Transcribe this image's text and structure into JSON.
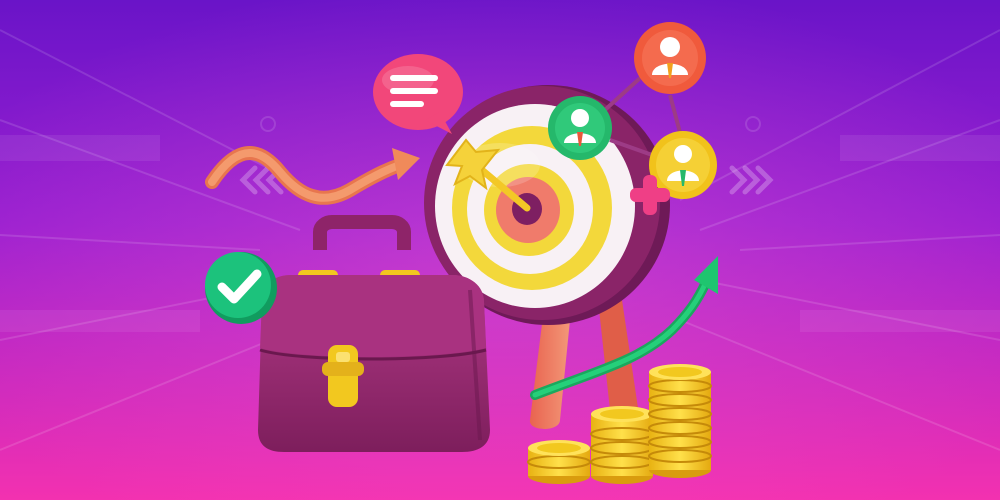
{
  "scene": {
    "description_colors": {
      "bg_top": "#6b15c9",
      "bg_bottom": "#f02fb4",
      "target_rim": "#7e1f62",
      "target_white": "#f7f1f4",
      "target_yellow": "#f3d83b",
      "target_coral": "#f07b6b",
      "briefcase": "#9e2a74",
      "briefcase_dark": "#7a1d58",
      "coin_gold": "#f2c81f",
      "check_green": "#19c07a",
      "arrow_green": "#19c86d",
      "arrow_orange": "#f08a5a",
      "speech_pink": "#f2477a",
      "avatar_red": "#f05a3c",
      "avatar_green": "#25b86b",
      "avatar_yellow": "#f1c21b",
      "plus_pink": "#ef3f86"
    },
    "icons": [
      "target-icon",
      "briefcase-icon",
      "checkmark-icon",
      "speech-bubble-icon",
      "avatar-icon",
      "coin-stack-icon",
      "trend-arrow-icon",
      "dart-icon",
      "plus-icon"
    ]
  }
}
